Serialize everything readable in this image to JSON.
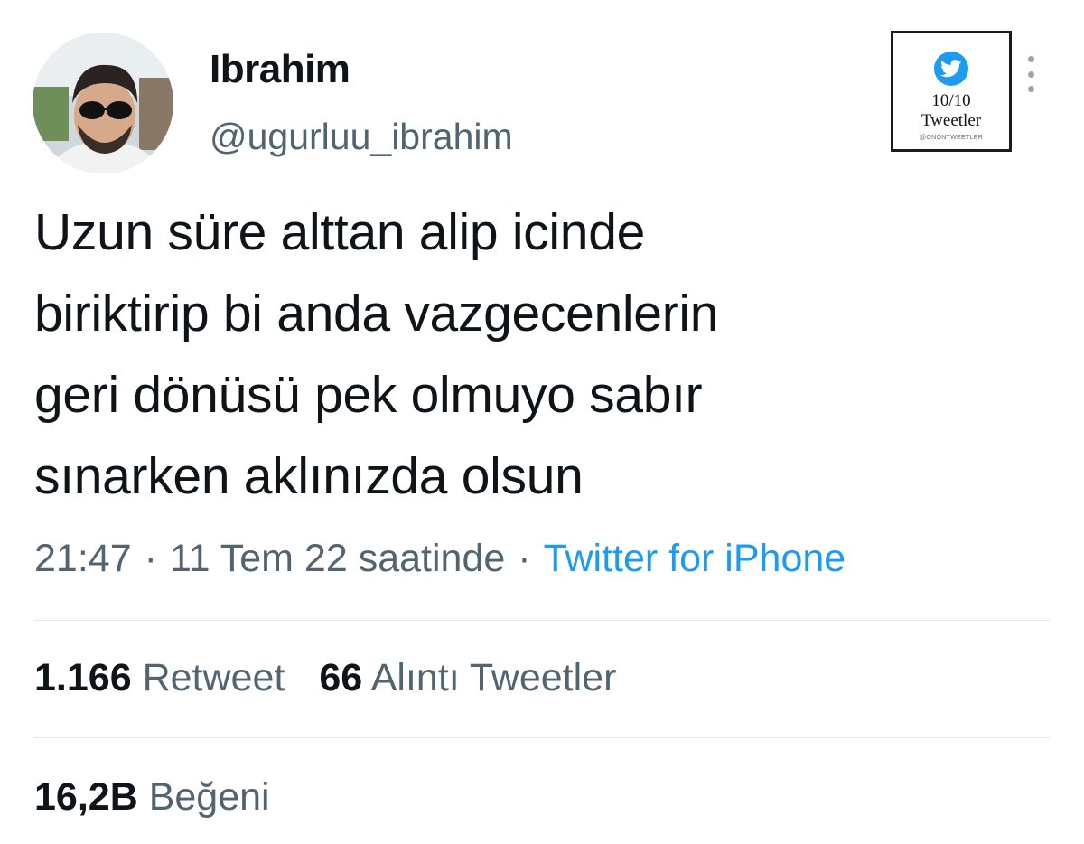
{
  "author": {
    "display_name": "Ibrahim",
    "handle": "@ugurluu_ibrahim"
  },
  "badge": {
    "score": "10/10",
    "label": "Tweetler",
    "signature": "@ONONTWEETLER"
  },
  "tweet": {
    "lines": [
      "Uzun süre alttan alip icinde",
      "biriktirip bi anda vazgecenlerin",
      "geri dönüsü pek olmuyo sabır",
      "sınarken aklınızda olsun"
    ]
  },
  "meta": {
    "time": "21:47",
    "separator": "·",
    "date": "11 Tem 22 saatinde",
    "source": "Twitter for iPhone"
  },
  "stats": {
    "retweets_count": "1.166",
    "retweets_label": "Retweet",
    "quotes_count": "66",
    "quotes_label": "Alıntı Tweetler",
    "likes_count": "16,2B",
    "likes_label": "Beğeni"
  },
  "colors": {
    "text_primary": "#0f1419",
    "text_secondary": "#536471",
    "link": "#1d9bf0",
    "divider": "#e5e8eb"
  }
}
